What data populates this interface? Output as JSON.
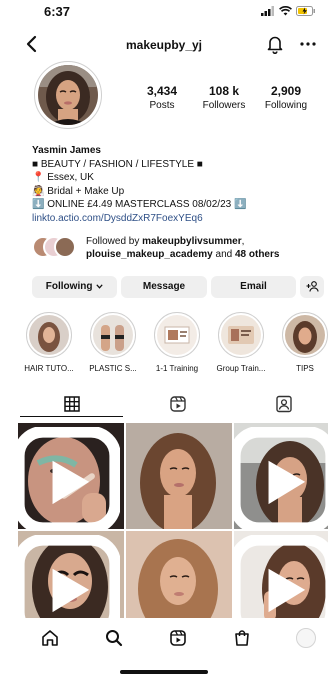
{
  "status": {
    "time": "6:37"
  },
  "header": {
    "username": "makeupby_yj"
  },
  "stats": [
    {
      "value": "3,434",
      "label": "Posts"
    },
    {
      "value": "108 k",
      "label": "Followers"
    },
    {
      "value": "2,909",
      "label": "Following"
    }
  ],
  "bio": {
    "name": "Yasmin James",
    "line1": "■ BEAUTY / FASHION / LIFESTYLE ■",
    "line2": "📍 Essex, UK",
    "line3": "👰 Bridal + Make Up",
    "line4": "⬇️ ONLINE £4.49 MASTERCLASS 08/02/23 ⬇️",
    "link": "linkto.actio.com/DysddZxR7FoexYEq6"
  },
  "followed": {
    "prefix": "Followed by ",
    "user1": "makeupbylivsummer",
    "sep": ",",
    "user2": "plouise_makeup_academy",
    "mid": " and ",
    "others": "48 others"
  },
  "actions": {
    "following": "Following",
    "message": "Message",
    "email": "Email"
  },
  "highlights": [
    {
      "label": "HAIR TUTO..."
    },
    {
      "label": "PLASTIC S..."
    },
    {
      "label": "1-1 Training"
    },
    {
      "label": "Group Train..."
    },
    {
      "label": "TIPS"
    }
  ],
  "colors": {
    "link": "#2e4f86",
    "button_bg": "#efefef",
    "text": "#111111"
  }
}
